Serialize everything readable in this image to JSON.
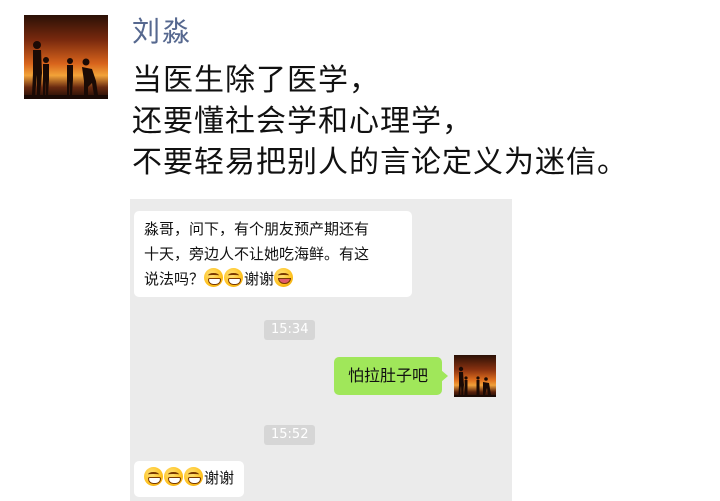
{
  "post": {
    "author": "刘淼",
    "lines": [
      "当医生除了医学，",
      "还要懂社会学和心理学，",
      "不要轻易把别人的言论定义为迷信。"
    ]
  },
  "chat": {
    "message_in_1": {
      "line1": "淼哥，问下，有个朋友预产期还有",
      "line2": "十天，旁边人不让她吃海鲜。有这",
      "line3_text": "说法吗？",
      "line3_thanks": "谢谢",
      "emoji_icons": [
        "grinning-face-icon",
        "grinning-face-icon",
        "winking-tongue-face-icon"
      ]
    },
    "timestamp_1": "15:34",
    "message_out_1": "怕拉肚子吧",
    "timestamp_2": "15:52",
    "message_in_2": {
      "thanks": "谢谢",
      "emoji_icons": [
        "grinning-face-icon",
        "grinning-face-icon",
        "grinning-face-icon"
      ]
    }
  },
  "colors": {
    "author_name": "#56688f",
    "chat_background": "#ebebeb",
    "outgoing_bubble": "#a0e75a",
    "timestamp_pill": "#d6d6d6"
  }
}
